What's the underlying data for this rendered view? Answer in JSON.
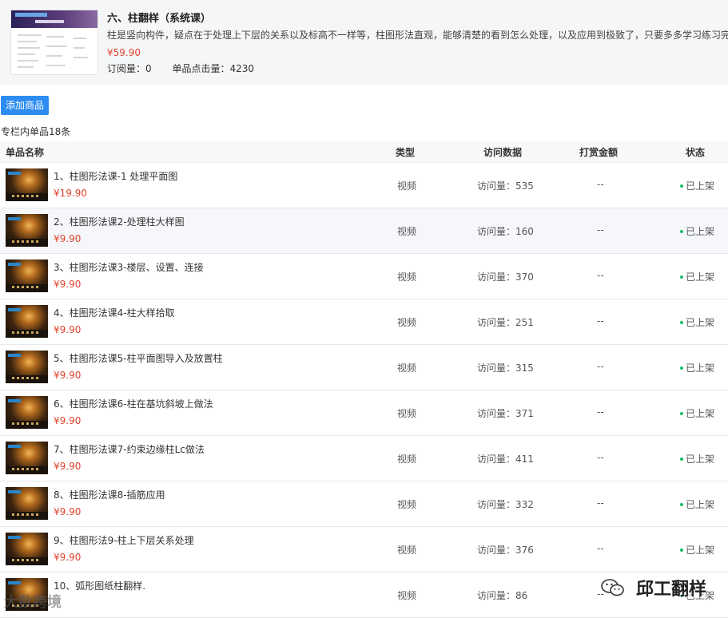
{
  "column": {
    "title": "六、柱翻样（系统课）",
    "description": "柱是竖向构件，疑点在于处理上下层的关系以及标高不一样等，柱图形法直观，能够清楚的看到怎么处理，以及应用到极致了，只要多多学习练习完",
    "price": "¥59.90",
    "subscriptions": "订阅量：0",
    "item_clicks": "单品点击量：4230"
  },
  "toolbar": {
    "add_label": "添加商品"
  },
  "list_count": "专栏内单品18条",
  "table": {
    "headers": {
      "name": "单品名称",
      "type": "类型",
      "visits": "访问数据",
      "tips": "打赏金额",
      "status": "状态"
    },
    "rows": [
      {
        "name": "1、柱图形法课-1 处理平面图",
        "price": "¥19.90",
        "type": "视频",
        "visits": "访问量：535",
        "tips": "--",
        "status": "已上架"
      },
      {
        "name": "2、柱图形法课2-处理柱大样图",
        "price": "¥9.90",
        "type": "视频",
        "visits": "访问量：160",
        "tips": "--",
        "status": "已上架"
      },
      {
        "name": "3、柱图形法课3-楼层、设置、连接",
        "price": "¥9.90",
        "type": "视频",
        "visits": "访问量：370",
        "tips": "--",
        "status": "已上架"
      },
      {
        "name": "4、柱图形法课4-柱大样拾取",
        "price": "¥9.90",
        "type": "视频",
        "visits": "访问量：251",
        "tips": "--",
        "status": "已上架"
      },
      {
        "name": "5、柱图形法课5-柱平面图导入及放置柱",
        "price": "¥9.90",
        "type": "视频",
        "visits": "访问量：315",
        "tips": "--",
        "status": "已上架"
      },
      {
        "name": "6、柱图形法课6-柱在基坑斜坡上做法",
        "price": "¥9.90",
        "type": "视频",
        "visits": "访问量：371",
        "tips": "--",
        "status": "已上架"
      },
      {
        "name": "7、柱图形法课7-约束边缘柱Lc做法",
        "price": "¥9.90",
        "type": "视频",
        "visits": "访问量：411",
        "tips": "--",
        "status": "已上架"
      },
      {
        "name": "8、柱图形法课8-插筋应用",
        "price": "¥9.90",
        "type": "视频",
        "visits": "访问量：332",
        "tips": "--",
        "status": "已上架"
      },
      {
        "name": "9、柱图形法9-柱上下层关系处理",
        "price": "¥9.90",
        "type": "视频",
        "visits": "访问量：376",
        "tips": "--",
        "status": "已上架"
      },
      {
        "name": "10、弧形图纸柱翻样.",
        "price": "",
        "type": "视频",
        "visits": "访问量：86",
        "tips": "--",
        "status": "已上架"
      }
    ]
  },
  "watermarks": {
    "left": "大数跨境",
    "right": "邱工翻样"
  },
  "colors": {
    "accent": "#2d8cf0",
    "price": "#e0432e",
    "status_dot": "#19be6b"
  }
}
